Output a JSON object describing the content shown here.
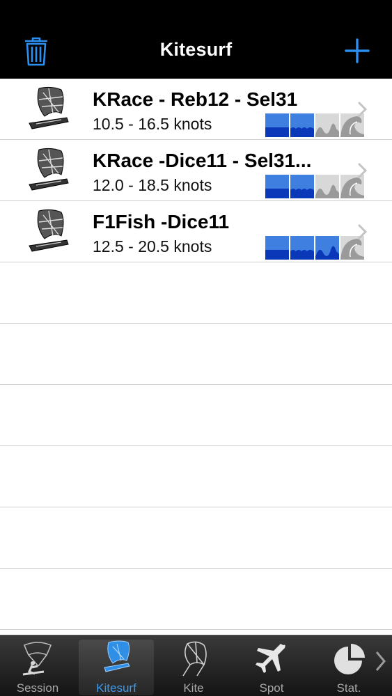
{
  "navbar": {
    "title": "Kitesurf",
    "trash_icon": "trash-icon",
    "add_icon": "plus-icon",
    "accent_color": "#2a8ff0"
  },
  "rows": [
    {
      "title": "KRace - Reb12 - Sel31",
      "subtitle": "10.5 - 16.5 knots",
      "sea_state": [
        "flat",
        "chop",
        "wave",
        "big-wave"
      ],
      "active_levels": 2
    },
    {
      "title": "KRace -Dice11 - Sel31...",
      "subtitle": "12.0 - 18.5 knots",
      "sea_state": [
        "flat",
        "chop",
        "wave",
        "big-wave"
      ],
      "active_levels": 2
    },
    {
      "title": "F1Fish -Dice11",
      "subtitle": "12.5 - 20.5 knots",
      "sea_state": [
        "flat",
        "chop",
        "wave",
        "big-wave"
      ],
      "active_levels": 3
    }
  ],
  "tabbar": {
    "tabs": [
      {
        "label": "Session",
        "icon": "kitesurfer-icon",
        "active": false
      },
      {
        "label": "Kitesurf",
        "icon": "kite-board-icon",
        "active": true
      },
      {
        "label": "Kite",
        "icon": "kite-icon",
        "active": false
      },
      {
        "label": "Spot",
        "icon": "airplane-icon",
        "active": false
      },
      {
        "label": "Stat.",
        "icon": "pie-chart-icon",
        "active": false
      }
    ],
    "active_color": "#3a9bf0"
  }
}
